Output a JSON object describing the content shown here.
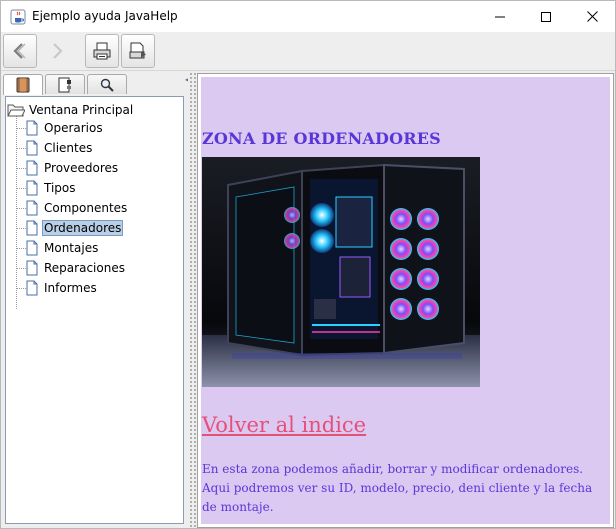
{
  "window": {
    "title": "Ejemplo ayuda JavaHelp",
    "controls": [
      "minimize",
      "maximize",
      "close"
    ]
  },
  "toolbar": {
    "buttons": [
      {
        "icon": "back-arrow-icon",
        "enabled": true
      },
      {
        "icon": "forward-arrow-icon",
        "enabled": false
      },
      {
        "icon": "print-icon",
        "enabled": true
      },
      {
        "icon": "page-setup-icon",
        "enabled": true
      }
    ]
  },
  "navigator": {
    "tabs": [
      {
        "icon": "book-icon",
        "active": true
      },
      {
        "icon": "index-icon",
        "active": false
      },
      {
        "icon": "search-icon",
        "active": false
      }
    ],
    "tree": {
      "root": "Ventana Principal",
      "items": [
        "Operarios",
        "Clientes",
        "Proveedores",
        "Tipos",
        "Componentes",
        "Ordenadores",
        "Montajes",
        "Reparaciones",
        "Informes"
      ],
      "selected": "Ordenadores"
    }
  },
  "content": {
    "heading": "ZONA DE ORDENADORES",
    "image_subject": "gaming-pc-case-rgb-fans",
    "link": "Volver al indice",
    "description": "En esta zona podemos añadir, borrar y modificar ordenadores. Aqui podremos ver su ID, modelo, precio, deni cliente y la fecha de montaje."
  },
  "colors": {
    "content_background": "#dbc9f1",
    "heading_text": "#5a36d9",
    "link_text": "#e5507a",
    "selection": "#b8cfe5"
  }
}
